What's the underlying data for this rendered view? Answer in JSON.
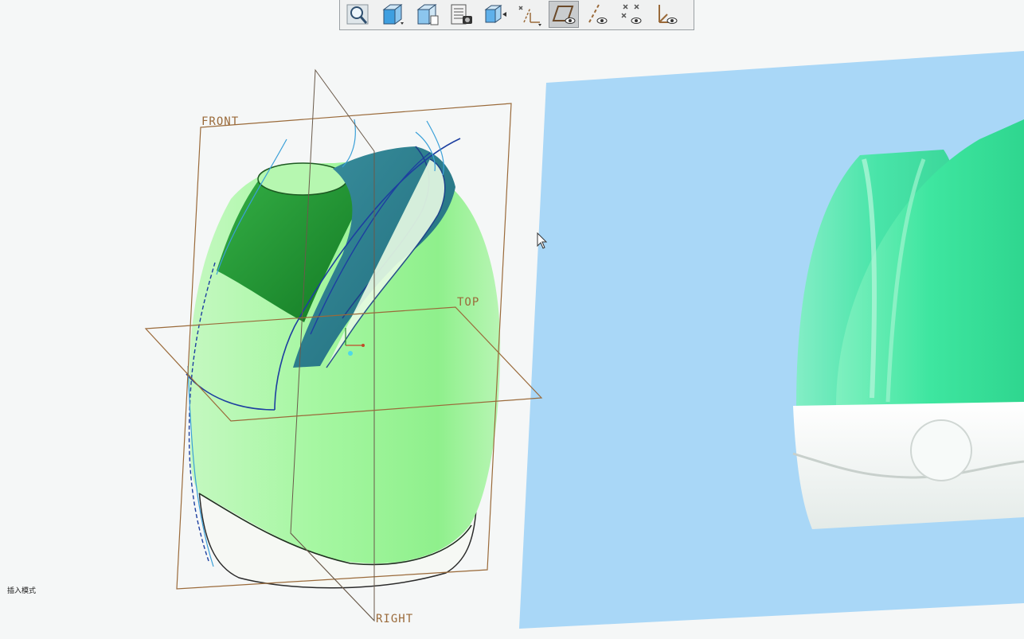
{
  "toolbar": {
    "items": [
      {
        "name": "zoom-to-fit-icon"
      },
      {
        "name": "saved-views-icon"
      },
      {
        "name": "view-manager-icon"
      },
      {
        "name": "appearance-gallery-icon"
      },
      {
        "name": "display-style-icon"
      },
      {
        "name": "datum-display-filters-icon"
      },
      {
        "name": "plane-display-icon",
        "active": true
      },
      {
        "name": "axis-display-icon"
      },
      {
        "name": "point-display-icon"
      },
      {
        "name": "csys-display-icon"
      }
    ]
  },
  "datum_planes": {
    "front": "FRONT",
    "top": "TOP",
    "right": "RIGHT"
  },
  "status": {
    "text": "插入模式"
  },
  "colors": {
    "model_green": "#9ef59a",
    "dark_green": "#1f8f2e",
    "teal_surface": "#2e7f8f",
    "datum_plane": "#9a6a3a",
    "reference_image_bg": "#a9d7f7",
    "reference_green": "#3ee6a0",
    "reference_white": "#f4f7f6"
  }
}
